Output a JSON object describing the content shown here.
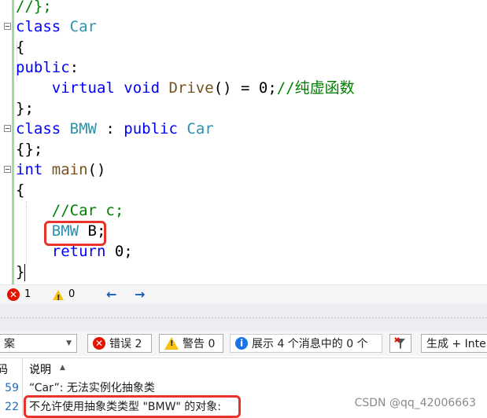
{
  "editor": {
    "lines": [
      {
        "fold": false,
        "segments": [
          {
            "t": "//};",
            "c": "cm"
          }
        ]
      },
      {
        "fold": true,
        "segments": [
          {
            "t": "class ",
            "c": "kw"
          },
          {
            "t": "Car",
            "c": "ty"
          }
        ]
      },
      {
        "fold": false,
        "segments": [
          {
            "t": "{",
            "c": ""
          }
        ]
      },
      {
        "fold": false,
        "segments": [
          {
            "t": "public",
            "c": "kw"
          },
          {
            "t": ":",
            "c": ""
          }
        ]
      },
      {
        "fold": false,
        "segments": [
          {
            "t": "    virtual ",
            "c": "kw"
          },
          {
            "t": "void ",
            "c": "kw"
          },
          {
            "t": "Drive",
            "c": "fn"
          },
          {
            "t": "() = 0;",
            "c": ""
          },
          {
            "t": "//纯虚函数",
            "c": "cm"
          }
        ]
      },
      {
        "fold": false,
        "segments": [
          {
            "t": "};",
            "c": ""
          }
        ]
      },
      {
        "fold": true,
        "segments": [
          {
            "t": "class ",
            "c": "kw"
          },
          {
            "t": "BMW",
            "c": "ty"
          },
          {
            "t": " : ",
            "c": ""
          },
          {
            "t": "public ",
            "c": "kw"
          },
          {
            "t": "Car",
            "c": "ty"
          }
        ]
      },
      {
        "fold": false,
        "segments": [
          {
            "t": "{};",
            "c": ""
          }
        ]
      },
      {
        "fold": true,
        "segments": [
          {
            "t": "int ",
            "c": "kw"
          },
          {
            "t": "main",
            "c": "fn"
          },
          {
            "t": "()",
            "c": ""
          }
        ]
      },
      {
        "fold": false,
        "segments": [
          {
            "t": "{",
            "c": ""
          }
        ]
      },
      {
        "fold": false,
        "segments": [
          {
            "t": "    //Car c;",
            "c": "cm"
          }
        ]
      },
      {
        "fold": false,
        "segments": [
          {
            "t": "    ",
            "c": ""
          },
          {
            "t": "BMW",
            "c": "ty"
          },
          {
            "t": " B;",
            "c": ""
          }
        ]
      },
      {
        "fold": false,
        "segments": [
          {
            "t": "    return ",
            "c": "kw"
          },
          {
            "t": "0;",
            "c": ""
          }
        ]
      },
      {
        "fold": false,
        "segments": [
          {
            "t": "}",
            "c": ""
          }
        ]
      }
    ]
  },
  "status": {
    "errors": "1",
    "warnings": "0",
    "back_arrow": "←",
    "forward_arrow": "→"
  },
  "toolbar": {
    "scope_dropdown_text": "案",
    "errors_button": "错误 2",
    "warnings_button": "警告 0",
    "messages_button": "展示 4 个消息中的 0 个",
    "build_dropdown_text": "生成 + Inte"
  },
  "grid": {
    "col_code_header": "码",
    "col_desc_header": "说明",
    "rows": [
      {
        "code": "59",
        "description": "“Car”: 无法实例化抽象类"
      },
      {
        "code": "22",
        "description": "不允许使用抽象类类型 \"BMW\" 的对象:"
      }
    ]
  },
  "watermark": "CSDN @qq_42006663",
  "colors": {
    "keyword": "#0000ff",
    "type": "#2b91af",
    "comment": "#008000",
    "error": "#e51400",
    "highlight_box": "#e8322b"
  }
}
